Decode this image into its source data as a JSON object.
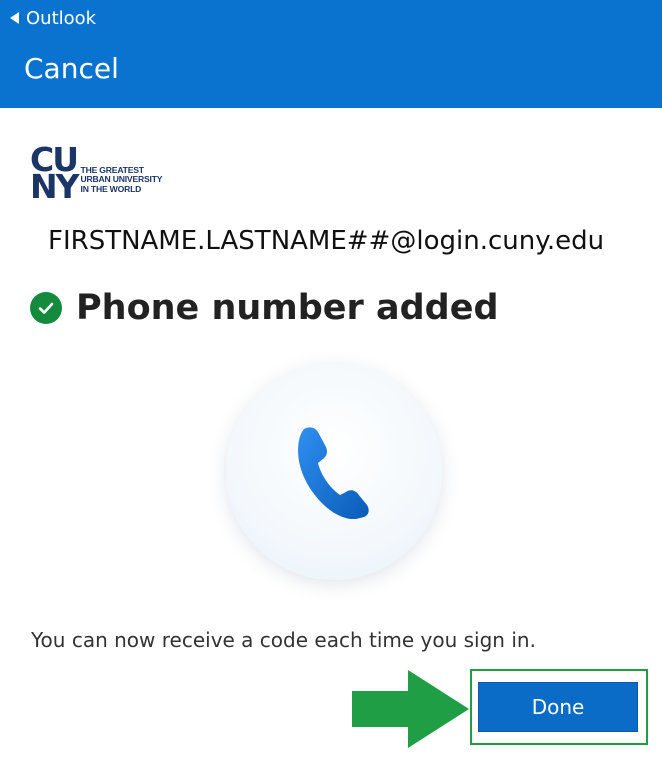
{
  "header": {
    "back_label": "Outlook",
    "cancel_label": "Cancel",
    "background_color": "#0a72cf"
  },
  "logo": {
    "line1": "CU",
    "line2": "NY",
    "tagline": [
      "THE GREATEST",
      "URBAN UNIVERSITY",
      "IN THE WORLD"
    ],
    "color": "#1b3566"
  },
  "account": {
    "email": "FIRSTNAME.LASTNAME##@login.cuny.edu"
  },
  "status": {
    "icon": "check-circle-icon",
    "title": "Phone number added",
    "color": "#138a3c"
  },
  "illustration": {
    "icon": "phone-icon"
  },
  "message": "You can now receive a code each time you sign in.",
  "actions": {
    "done_label": "Done",
    "button_color": "#0a6cc7",
    "highlight_color": "#1f9e45"
  }
}
